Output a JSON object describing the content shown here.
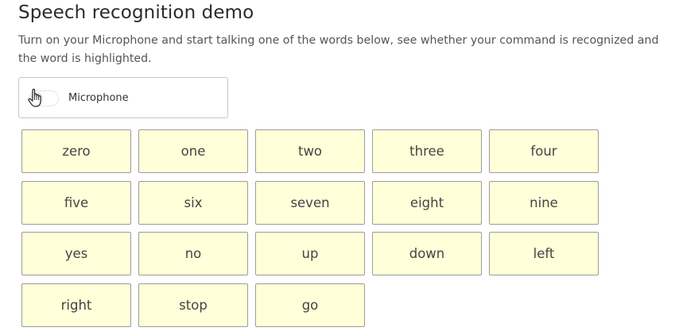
{
  "header": {
    "title": "Speech recognition demo",
    "description": "Turn on your Microphone and start talking one of the words below, see whether your command is recognized and the word is highlighted."
  },
  "microphone": {
    "label": "Microphone",
    "toggle_state": "off"
  },
  "words": [
    "zero",
    "one",
    "two",
    "three",
    "four",
    "five",
    "six",
    "seven",
    "eight",
    "nine",
    "yes",
    "no",
    "up",
    "down",
    "left",
    "right",
    "stop",
    "go"
  ],
  "colors": {
    "word_background": "#ffffd9",
    "word_border": "#9c9c9c",
    "card_border": "#b9ccd4"
  }
}
